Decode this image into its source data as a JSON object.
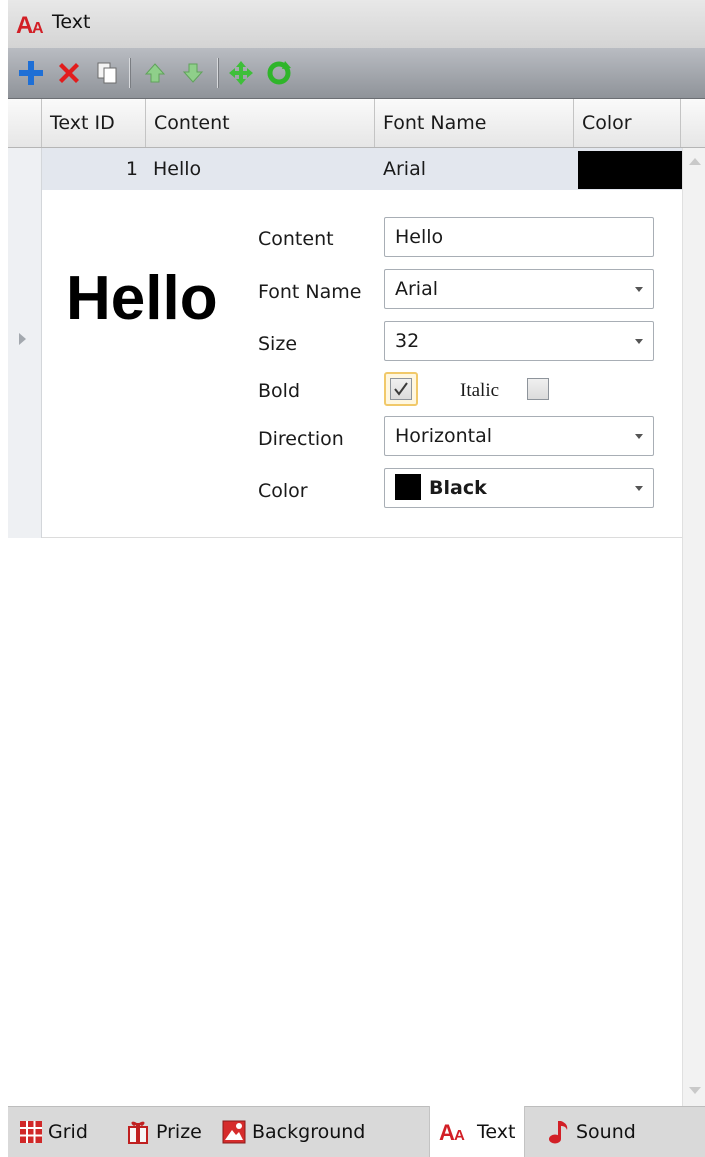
{
  "window": {
    "title": "Text",
    "title_icon": "text-aa-icon"
  },
  "toolbar": {
    "buttons": [
      {
        "name": "add",
        "icon": "plus-icon"
      },
      {
        "name": "delete",
        "icon": "x-icon"
      },
      {
        "name": "copy",
        "icon": "copy-icon"
      },
      {
        "name": "move-up",
        "icon": "arrow-up-icon"
      },
      {
        "name": "move-down",
        "icon": "arrow-down-icon"
      },
      {
        "name": "move",
        "icon": "move-icon"
      },
      {
        "name": "refresh",
        "icon": "refresh-icon"
      }
    ]
  },
  "grid": {
    "columns": [
      "Text ID",
      "Content",
      "Font Name",
      "Color"
    ],
    "rows": [
      {
        "text_id": "1",
        "content": "Hello",
        "font_name": "Arial",
        "color": "#000000"
      }
    ]
  },
  "detail": {
    "preview_text": "Hello",
    "labels": {
      "content": "Content",
      "font_name": "Font Name",
      "size": "Size",
      "bold": "Bold",
      "italic": "Italic",
      "direction": "Direction",
      "color": "Color"
    },
    "values": {
      "content": "Hello",
      "font_name": "Arial",
      "size": "32",
      "bold": true,
      "italic": false,
      "direction": "Horizontal",
      "color": "Black",
      "color_hex": "#000000"
    }
  },
  "tabs": [
    {
      "label": "Grid",
      "icon": "grid-icon",
      "active": false
    },
    {
      "label": "Prize",
      "icon": "prize-icon",
      "active": false
    },
    {
      "label": "Background",
      "icon": "background-icon",
      "active": false
    },
    {
      "label": "Text",
      "icon": "text-aa-icon",
      "active": true
    },
    {
      "label": "Sound",
      "icon": "music-note-icon",
      "active": false
    }
  ]
}
